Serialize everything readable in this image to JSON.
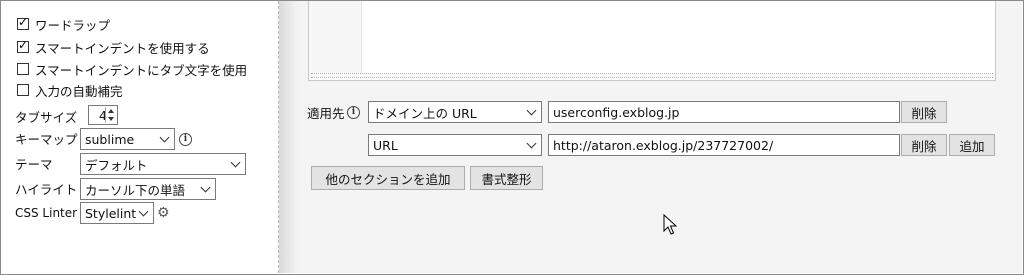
{
  "options": {
    "word_wrap": {
      "label": "ワードラップ",
      "checked": true
    },
    "smart_indent": {
      "label": "スマートインデントを使用する",
      "checked": true
    },
    "smart_indent_tabs": {
      "label": "スマートインデントにタブ文字を使用",
      "checked": false
    },
    "auto_complete": {
      "label": "入力の自動補完",
      "checked": false
    },
    "tab_size": {
      "label": "タブサイズ",
      "value": "4"
    },
    "keymap": {
      "label": "キーマップ",
      "value": "sublime"
    },
    "theme": {
      "label": "テーマ",
      "value": "デフォルト"
    },
    "highlight": {
      "label": "ハイライト",
      "value": "カーソル下の単語"
    },
    "linter": {
      "label": "CSS Linter",
      "value": "Stylelint"
    }
  },
  "applies": {
    "label": "適用先",
    "rows": [
      {
        "type": "ドメイン上の URL",
        "value": "userconfig.exblog.jp",
        "delete_label": "削除"
      },
      {
        "type": "URL",
        "value": "http://ataron.exblog.jp/237727002/",
        "delete_label": "削除",
        "add_label": "追加"
      }
    ]
  },
  "actions": {
    "add_section": "他のセクションを追加",
    "format": "書式整形"
  },
  "icons": {
    "info": "info-icon",
    "gear": "gear-icon",
    "cursor": "mouse-pointer-icon"
  }
}
